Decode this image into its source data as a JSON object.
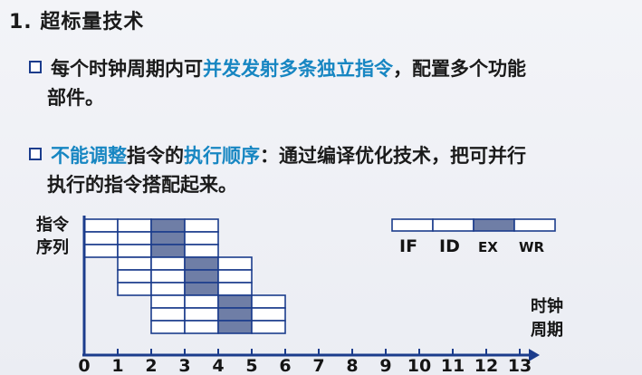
{
  "title": "1. 超标量技术",
  "bullet1": {
    "pre": "每个时钟周期内可",
    "highlight": "并发发射多条独立指令",
    "post": "，配置多个功能",
    "line2": "部件。"
  },
  "bullet2": {
    "highlight1": "不能调整",
    "mid1": "指令的",
    "highlight2": "执行顺序",
    "post": "：通过编译优化技术，把可并行",
    "line2": "执行的指令搭配起来。"
  },
  "diagram": {
    "y_label_line1": "指令",
    "y_label_line2": "序列",
    "x_label_line1": "时钟",
    "x_label_line2": "周期",
    "ticks": [
      "0",
      "1",
      "2",
      "3",
      "4",
      "5",
      "6",
      "7",
      "8",
      "9",
      "10",
      "11",
      "12",
      "13"
    ],
    "instructions": [
      {
        "start": 0,
        "ex_stage": 2
      },
      {
        "start": 0,
        "ex_stage": 2
      },
      {
        "start": 0,
        "ex_stage": 2
      },
      {
        "start": 1,
        "ex_stage": 2
      },
      {
        "start": 1,
        "ex_stage": 2
      },
      {
        "start": 1,
        "ex_stage": 2
      },
      {
        "start": 2,
        "ex_stage": 2
      },
      {
        "start": 2,
        "ex_stage": 2
      },
      {
        "start": 2,
        "ex_stage": 2
      }
    ],
    "legend": [
      "IF",
      "ID",
      "EX",
      "WR"
    ],
    "legend_highlight_index": 2,
    "fill_color": "#6f7ea6",
    "line_color": "#1b3c8c"
  }
}
